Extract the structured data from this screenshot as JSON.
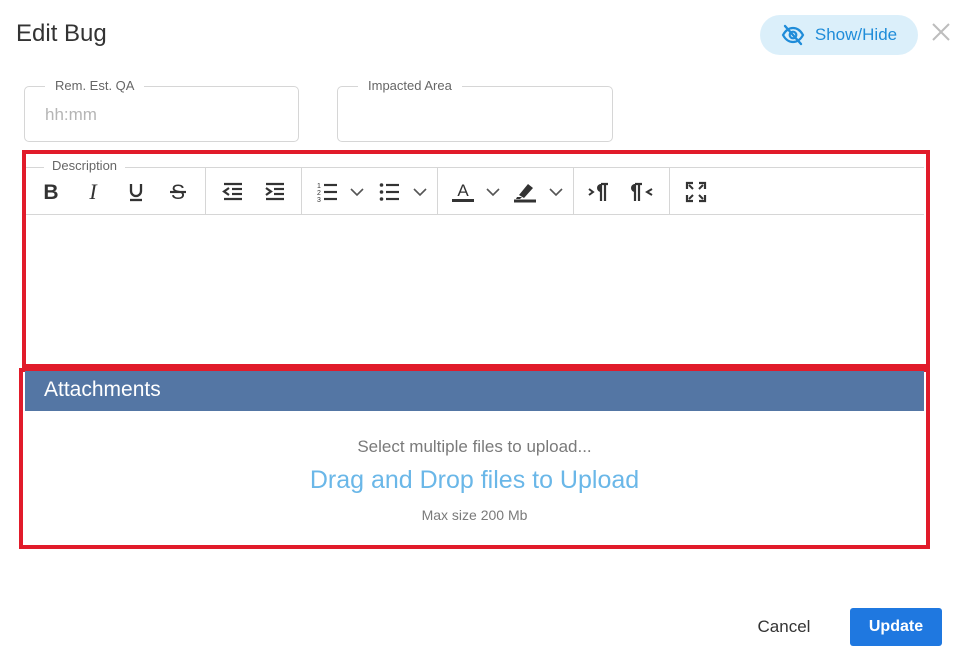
{
  "dialog": {
    "title": "Edit Bug",
    "show_hide_label": "Show/Hide"
  },
  "fields": {
    "rem_est_qa": {
      "label": "Rem. Est. QA",
      "placeholder": "hh:mm",
      "value": ""
    },
    "impacted_area": {
      "label": "Impacted Area",
      "value": ""
    }
  },
  "description": {
    "label": "Description",
    "toolbar": [
      "bold",
      "italic",
      "underline",
      "strikethrough",
      "outdent",
      "indent",
      "ordered-list",
      "unordered-list",
      "font-color",
      "highlight-color",
      "ltr",
      "rtl",
      "fullscreen"
    ]
  },
  "attachments": {
    "header": "Attachments",
    "hint": "Select multiple files to upload...",
    "drop_label": "Drag and Drop files to Upload",
    "max_size": "Max size 200 Mb"
  },
  "footer": {
    "cancel_label": "Cancel",
    "update_label": "Update"
  },
  "colors": {
    "accent": "#1f78e0",
    "attachments_header": "#5476a4",
    "highlight_box": "#e11b2a",
    "drop_link": "#6ab7e8",
    "show_hide_bg": "#dbeffa"
  }
}
